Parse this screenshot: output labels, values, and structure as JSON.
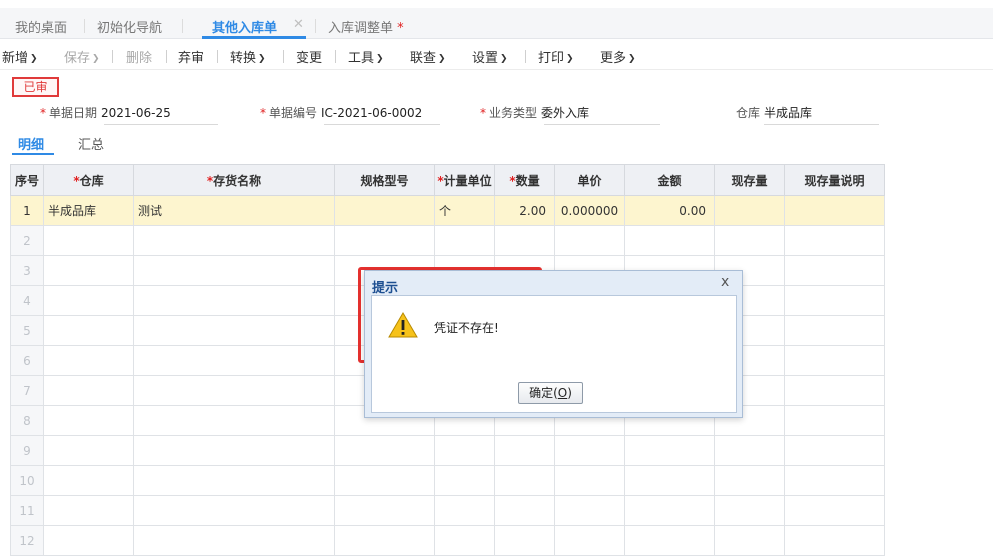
{
  "tabs": [
    {
      "label": "我的桌面",
      "active": false
    },
    {
      "label": "初始化导航",
      "active": false
    },
    {
      "label": "其他入库单",
      "active": true
    },
    {
      "label": "入库调整单",
      "active": false,
      "modified": "*"
    }
  ],
  "toolbar": {
    "items": [
      {
        "label": "新增",
        "dropdown": true,
        "enabled": true
      },
      {
        "label": "保存",
        "dropdown": true,
        "enabled": false
      },
      {
        "label": "删除",
        "dropdown": false,
        "enabled": false
      },
      {
        "label": "弃审",
        "dropdown": false,
        "enabled": true
      },
      {
        "label": "转换",
        "dropdown": true,
        "enabled": true
      },
      {
        "label": "变更",
        "dropdown": false,
        "enabled": true
      },
      {
        "label": "工具",
        "dropdown": true,
        "enabled": true
      },
      {
        "label": "联查",
        "dropdown": true,
        "enabled": true
      },
      {
        "label": "设置",
        "dropdown": true,
        "enabled": true
      },
      {
        "label": "打印",
        "dropdown": true,
        "enabled": true
      },
      {
        "label": "更多",
        "dropdown": true,
        "enabled": true
      }
    ]
  },
  "status_stamp": "已审",
  "header_fields": {
    "date": {
      "label": "单据日期",
      "value": "2021-06-25",
      "required": true
    },
    "doc_no": {
      "label": "单据编号",
      "value": "IC-2021-06-0002",
      "required": true
    },
    "biz_type": {
      "label": "业务类型",
      "value": "委外入库",
      "required": true
    },
    "warehouse": {
      "label": "仓库",
      "value": "半成品库",
      "required": false
    }
  },
  "subtabs": [
    {
      "label": "明细",
      "active": true
    },
    {
      "label": "汇总",
      "active": false
    }
  ],
  "table": {
    "columns": [
      {
        "label": "序号",
        "required": false
      },
      {
        "label": "仓库",
        "required": true
      },
      {
        "label": "存货名称",
        "required": true
      },
      {
        "label": "规格型号",
        "required": false
      },
      {
        "label": "计量单位",
        "required": true
      },
      {
        "label": "数量",
        "required": true
      },
      {
        "label": "单价",
        "required": false
      },
      {
        "label": "金额",
        "required": false
      },
      {
        "label": "现存量",
        "required": false
      },
      {
        "label": "现存量说明",
        "required": false
      }
    ],
    "rows": [
      [
        "1",
        "半成品库",
        "测试",
        "",
        "个",
        "2.00",
        "0.000000",
        "0.00",
        "",
        ""
      ],
      [
        "2",
        "",
        "",
        "",
        "",
        "",
        "",
        "",
        "",
        ""
      ],
      [
        "3",
        "",
        "",
        "",
        "",
        "",
        "",
        "",
        "",
        ""
      ],
      [
        "4",
        "",
        "",
        "",
        "",
        "",
        "",
        "",
        "",
        ""
      ],
      [
        "5",
        "",
        "",
        "",
        "",
        "",
        "",
        "",
        "",
        ""
      ],
      [
        "6",
        "",
        "",
        "",
        "",
        "",
        "",
        "",
        "",
        ""
      ],
      [
        "7",
        "",
        "",
        "",
        "",
        "",
        "",
        "",
        "",
        ""
      ],
      [
        "8",
        "",
        "",
        "",
        "",
        "",
        "",
        "",
        "",
        ""
      ],
      [
        "9",
        "",
        "",
        "",
        "",
        "",
        "",
        "",
        "",
        ""
      ],
      [
        "10",
        "",
        "",
        "",
        "",
        "",
        "",
        "",
        "",
        ""
      ],
      [
        "11",
        "",
        "",
        "",
        "",
        "",
        "",
        "",
        "",
        ""
      ],
      [
        "12",
        "",
        "",
        "",
        "",
        "",
        "",
        "",
        "",
        ""
      ]
    ]
  },
  "dialog": {
    "title": "提示",
    "close": "x",
    "icon": "warning-icon",
    "message": "凭证不存在!",
    "ok_label": "确定(",
    "ok_key": "O",
    "ok_suffix": ")"
  },
  "colors": {
    "accent": "#2f8ae5",
    "required_mark": "#e02020",
    "stamp": "#e03a3a",
    "selected_row": "#fdf5cf",
    "highlight_box": "#e6312f"
  }
}
